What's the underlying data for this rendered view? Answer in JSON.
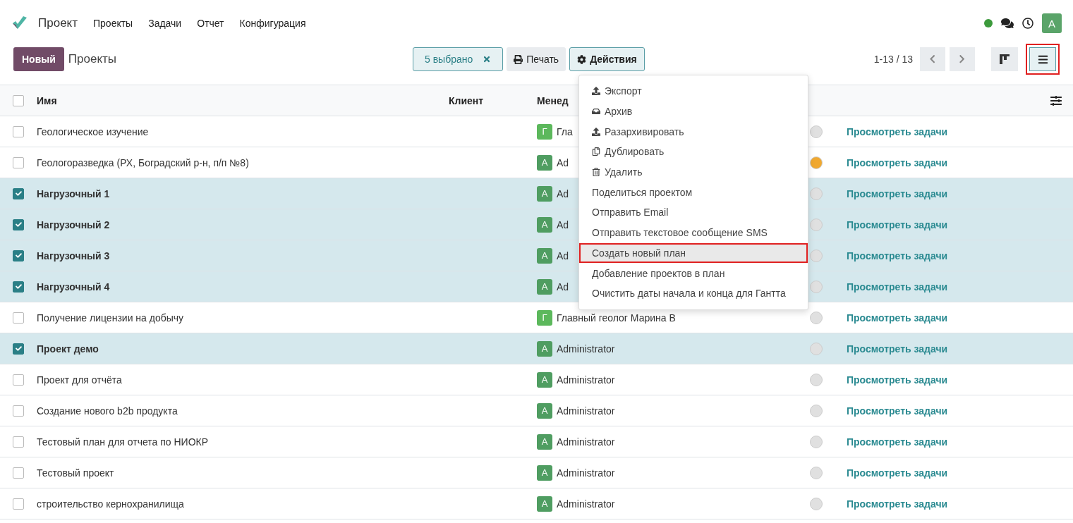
{
  "navbar": {
    "app": "Проект",
    "menu": [
      "Проекты",
      "Задачи",
      "Отчет",
      "Конфигурация"
    ],
    "online": true,
    "avatar": "A"
  },
  "control_panel": {
    "new_button": "Новый",
    "breadcrumb": "Проекты",
    "selection": "5 выбрано",
    "print_button": "Печать",
    "actions_button": "Действия",
    "pager": "1-13 / 13",
    "views": [
      {
        "kind": "kanban",
        "selected": false,
        "marked": false
      },
      {
        "kind": "list",
        "selected": true,
        "marked": true
      }
    ]
  },
  "table": {
    "columns": [
      "Имя",
      "Клиент",
      "Менед"
    ],
    "all_checked": false,
    "rows": [
      {
        "name": "Геологическое изучение",
        "selected": false,
        "avatar": {
          "letter": "Г",
          "color": "#5cb85c"
        },
        "manager": "Гла",
        "status": {
          "color": "#e0e0e0"
        },
        "link": "Просмотреть задачи"
      },
      {
        "name": "Геологоразведка (РХ, Боградский р-н, п/п №8)",
        "selected": false,
        "avatar": {
          "letter": "A",
          "color": "#4f9d61"
        },
        "manager": "Ad",
        "status": {
          "color": "#f0a830"
        },
        "link": "Просмотреть задачи"
      },
      {
        "name": "Нагрузочный 1",
        "selected": true,
        "avatar": {
          "letter": "A",
          "color": "#4f9d61"
        },
        "manager": "Ad",
        "status": {
          "color": "#e0e0e0"
        },
        "link": "Просмотреть задачи"
      },
      {
        "name": "Нагрузочный 2",
        "selected": true,
        "avatar": {
          "letter": "A",
          "color": "#4f9d61"
        },
        "manager": "Ad",
        "status": {
          "color": "#e0e0e0"
        },
        "link": "Просмотреть задачи"
      },
      {
        "name": "Нагрузочный 3",
        "selected": true,
        "avatar": {
          "letter": "A",
          "color": "#4f9d61"
        },
        "manager": "Ad",
        "status": {
          "color": "#e0e0e0"
        },
        "link": "Просмотреть задачи"
      },
      {
        "name": "Нагрузочный 4",
        "selected": true,
        "avatar": {
          "letter": "A",
          "color": "#4f9d61"
        },
        "manager": "Ad",
        "status": {
          "color": "#e0e0e0"
        },
        "link": "Просмотреть задачи"
      },
      {
        "name": "Получение лицензии на добычу",
        "selected": false,
        "avatar": {
          "letter": "Г",
          "color": "#5cb85c"
        },
        "manager": "Главный геолог Марина В",
        "status": {
          "color": "#e0e0e0"
        },
        "link": "Просмотреть задачи"
      },
      {
        "name": "Проект демо",
        "selected": true,
        "avatar": {
          "letter": "A",
          "color": "#4f9d61"
        },
        "manager": "Administrator",
        "status": {
          "color": "#e0e0e0"
        },
        "link": "Просмотреть задачи"
      },
      {
        "name": "Проект для отчёта",
        "selected": false,
        "avatar": {
          "letter": "A",
          "color": "#4f9d61"
        },
        "manager": "Administrator",
        "status": {
          "color": "#e0e0e0"
        },
        "link": "Просмотреть задачи"
      },
      {
        "name": "Создание нового b2b продукта",
        "selected": false,
        "avatar": {
          "letter": "A",
          "color": "#4f9d61"
        },
        "manager": "Administrator",
        "status": {
          "color": "#e0e0e0"
        },
        "link": "Просмотреть задачи"
      },
      {
        "name": "Тестовый план для отчета по НИОКР",
        "selected": false,
        "avatar": {
          "letter": "A",
          "color": "#4f9d61"
        },
        "manager": "Administrator",
        "status": {
          "color": "#e0e0e0"
        },
        "link": "Просмотреть задачи"
      },
      {
        "name": "Тестовый проект",
        "selected": false,
        "avatar": {
          "letter": "A",
          "color": "#4f9d61"
        },
        "manager": "Administrator",
        "status": {
          "color": "#e0e0e0"
        },
        "link": "Просмотреть задачи"
      },
      {
        "name": "строительство кернохранилища",
        "selected": false,
        "avatar": {
          "letter": "A",
          "color": "#4f9d61"
        },
        "manager": "Administrator",
        "status": {
          "color": "#e0e0e0"
        },
        "link": "Просмотреть задачи"
      }
    ]
  },
  "actions_menu": [
    {
      "label": "Экспорт",
      "kind": "export",
      "highlighted": false,
      "marked": false
    },
    {
      "label": "Архив",
      "kind": "archive",
      "highlighted": false,
      "marked": false
    },
    {
      "label": "Разархивировать",
      "kind": "unarchive",
      "highlighted": false,
      "marked": false
    },
    {
      "label": "Дублировать",
      "kind": "duplicate",
      "highlighted": false,
      "marked": false
    },
    {
      "label": "Удалить",
      "kind": "delete",
      "highlighted": false,
      "marked": false
    },
    {
      "label": "Поделиться проектом",
      "kind": "plain",
      "highlighted": false,
      "marked": false
    },
    {
      "label": "Отправить Email",
      "kind": "plain",
      "highlighted": false,
      "marked": false
    },
    {
      "label": "Отправить текстовое сообщение SMS",
      "kind": "plain",
      "highlighted": false,
      "marked": false
    },
    {
      "label": "Создать новый план",
      "kind": "plain",
      "highlighted": true,
      "marked": true
    },
    {
      "label": "Добавление проектов в план",
      "kind": "plain",
      "highlighted": false,
      "marked": false
    },
    {
      "label": "Очистить даты начала и конца для Гантта",
      "kind": "plain",
      "highlighted": false,
      "marked": false
    }
  ]
}
